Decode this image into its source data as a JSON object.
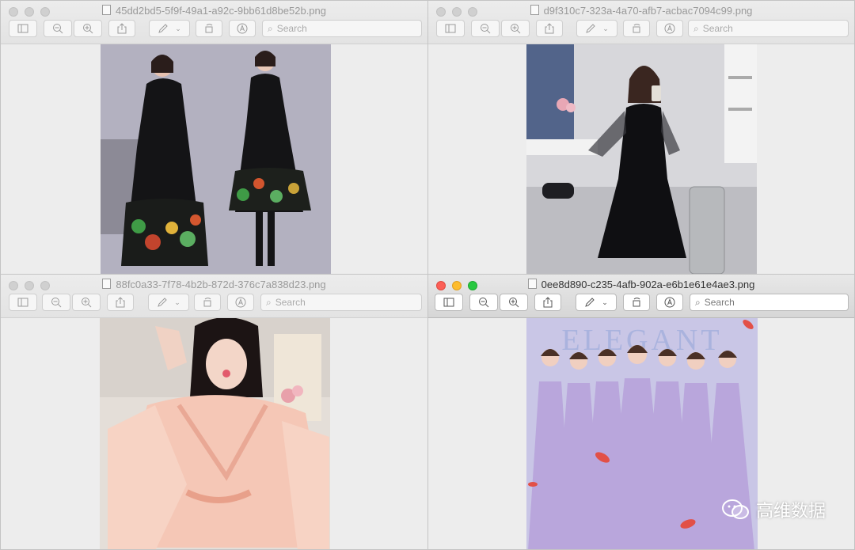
{
  "windows": [
    {
      "title": "45dd2bd5-5f9f-49a1-a92c-9bb61d8be52b.png",
      "search_placeholder": "Search"
    },
    {
      "title": "d9f310c7-323a-4a70-afb7-acbac7094c99.png",
      "search_placeholder": "Search"
    },
    {
      "title": "88fc0a33-7f78-4b2b-872d-376c7a838d23.png",
      "search_placeholder": "Search"
    },
    {
      "title": "0ee8d890-c235-4afb-902a-e6b1e61e4ae3.png",
      "search_placeholder": "Search"
    }
  ],
  "photo_overlay_text": "ELEGANT",
  "watermark": {
    "text": "高维数据",
    "icon": "wechat-icon"
  },
  "colors": {
    "close": "#fc5f57",
    "minimize": "#fdbc2e",
    "zoom": "#28c840"
  }
}
